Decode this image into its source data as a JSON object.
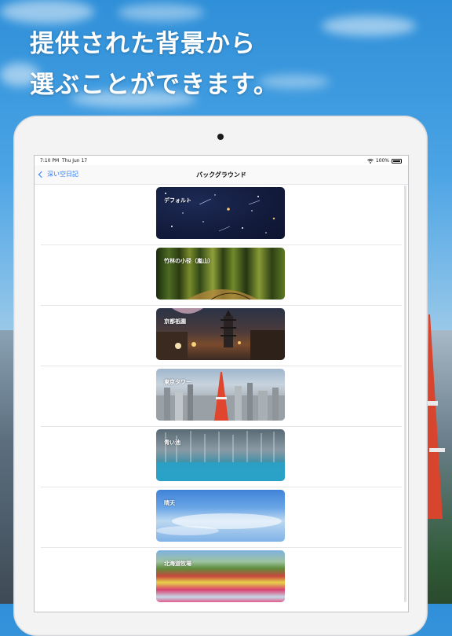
{
  "headline": {
    "line1": "提供された背景から",
    "line2": "選ぶことができます。"
  },
  "status_bar": {
    "time": "7:10 PM",
    "date": "Thu Jun 17",
    "battery": "100%"
  },
  "nav": {
    "back_label": "深い空日記",
    "title": "バックグラウンド"
  },
  "backgrounds": [
    {
      "label": "デフォルト"
    },
    {
      "label": "竹林の小径（嵐山）"
    },
    {
      "label": "京都祇園"
    },
    {
      "label": "東京タワー"
    },
    {
      "label": "青い池"
    },
    {
      "label": "晴天"
    },
    {
      "label": "北海道牧場"
    }
  ],
  "colors": {
    "accent": "#2f7cf6",
    "sky_top": "#2f8fd8"
  },
  "icons": {
    "back": "chevron-left-icon",
    "wifi": "wifi-icon",
    "battery": "battery-icon",
    "camera": "camera-dot"
  }
}
